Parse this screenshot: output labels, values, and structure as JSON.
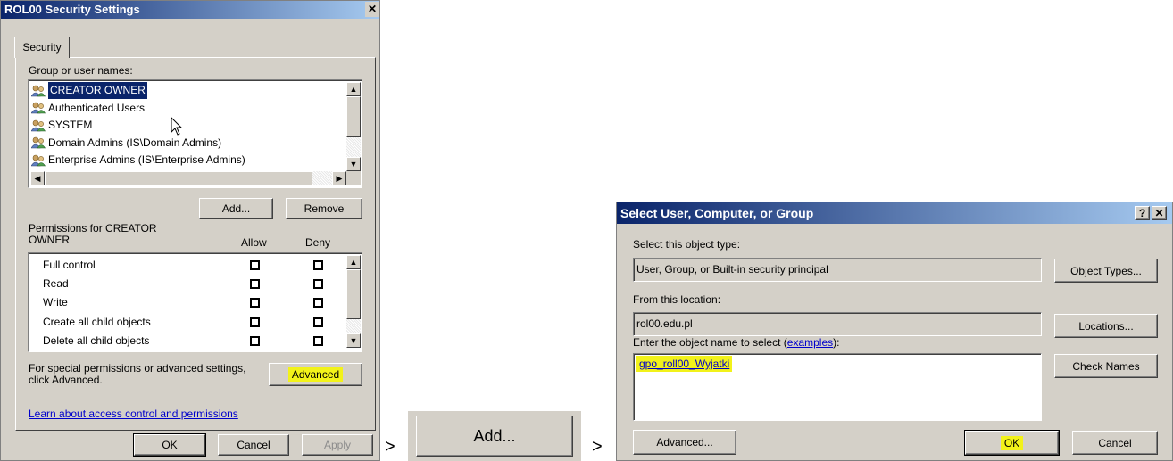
{
  "security_dialog": {
    "title": "ROL00 Security Settings",
    "close_glyph": "✕",
    "tab": "Security",
    "group_label": "Group or user names:",
    "users": [
      {
        "name": "CREATOR OWNER",
        "selected": true
      },
      {
        "name": "Authenticated Users",
        "selected": false
      },
      {
        "name": "SYSTEM",
        "selected": false
      },
      {
        "name": "Domain Admins (IS\\Domain Admins)",
        "selected": false
      },
      {
        "name": "Enterprise Admins (IS\\Enterprise Admins)",
        "selected": false
      }
    ],
    "add_label": "Add...",
    "remove_label": "Remove",
    "permissions_label_line1": "Permissions for CREATOR",
    "permissions_label_line2": "OWNER",
    "allow_header": "Allow",
    "deny_header": "Deny",
    "permissions": [
      {
        "name": "Full control",
        "allow": false,
        "deny": false
      },
      {
        "name": "Read",
        "allow": false,
        "deny": false
      },
      {
        "name": "Write",
        "allow": false,
        "deny": false
      },
      {
        "name": "Create all child objects",
        "allow": false,
        "deny": false
      },
      {
        "name": "Delete all child objects",
        "allow": false,
        "deny": false
      }
    ],
    "special_line1": "For special permissions or advanced settings,",
    "special_line2": "click Advanced.",
    "advanced_label": "Advanced",
    "learn_link": "Learn about access control and permissions",
    "ok_label": "OK",
    "cancel_label": "Cancel",
    "apply_label": "Apply"
  },
  "separator1": ">",
  "add_button_zoom": {
    "label": "Add..."
  },
  "separator2": ">",
  "select_dialog": {
    "title": "Select User, Computer, or Group",
    "help_glyph": "?",
    "close_glyph": "✕",
    "object_type_label": "Select this object type:",
    "object_type_value": "User, Group, or Built-in security principal",
    "object_types_button": "Object Types...",
    "location_label": "From this location:",
    "location_value": "rol00.edu.pl",
    "locations_button": "Locations...",
    "enter_label_prefix": "Enter the object name to select (",
    "enter_label_link": "examples",
    "enter_label_suffix": "):",
    "object_name_value": "gpo_roll00_Wyjatki",
    "check_names_button": "Check Names",
    "advanced_button": "Advanced...",
    "ok_button": "OK",
    "cancel_button": "Cancel"
  },
  "colors": {
    "title_bar": "#0a246a",
    "dialog_bg": "#d4d0c8",
    "highlight": "#f2f21a",
    "selection": "#0a246a"
  }
}
